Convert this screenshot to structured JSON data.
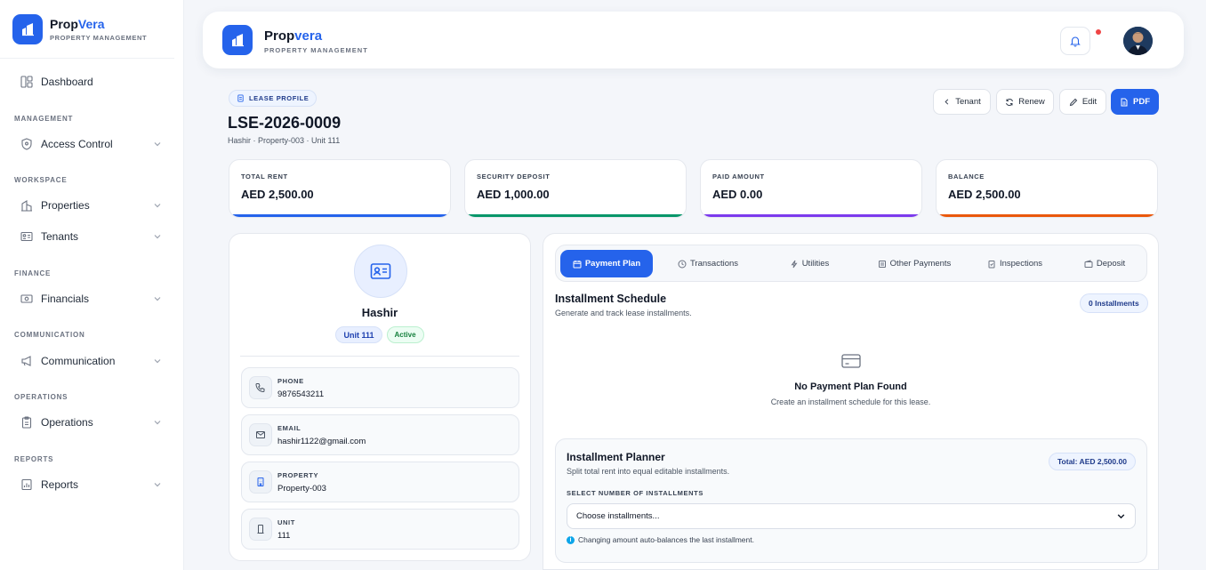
{
  "brand": {
    "name_a": "Prop",
    "name_b": "Vera",
    "sub": "PROPERTY MANAGEMENT"
  },
  "header": {
    "name_a": "Prop",
    "name_b": "vera",
    "sub": "PROPERTY MANAGEMENT",
    "bell_icon": "bell-icon",
    "accent": "#2563eb"
  },
  "sidebar": {
    "dashboard": "Dashboard",
    "sections": [
      "MANAGEMENT",
      "WORKSPACE",
      "FINANCE",
      "COMMUNICATION",
      "OPERATIONS",
      "REPORTS"
    ],
    "items": [
      "Access Control",
      "Properties",
      "Tenants",
      "Financials",
      "Communication",
      "Operations",
      "Reports"
    ]
  },
  "lease": {
    "chip": "LEASE PROFILE",
    "id": "LSE-2026-0009",
    "subtitle": "Hashir · Property-003 · Unit 111",
    "buttons": {
      "tenant": "Tenant",
      "renew": "Renew",
      "edit": "Edit",
      "pdf": "PDF"
    }
  },
  "stats": [
    {
      "label": "TOTAL RENT",
      "value": "AED 2,500.00",
      "color": "#2563eb"
    },
    {
      "label": "SECURITY DEPOSIT",
      "value": "AED 1,000.00",
      "color": "#059669"
    },
    {
      "label": "PAID AMOUNT",
      "value": "AED 0.00",
      "color": "#7c3aed"
    },
    {
      "label": "BALANCE",
      "value": "AED 2,500.00",
      "color": "#ea580c"
    }
  ],
  "tenant": {
    "name": "Hashir",
    "unit_badge": "Unit 111",
    "status": "Active",
    "fields": [
      {
        "label": "PHONE",
        "value": "9876543211"
      },
      {
        "label": "EMAIL",
        "value": "hashir1122@gmail.com"
      },
      {
        "label": "PROPERTY",
        "value": "Property-003"
      },
      {
        "label": "UNIT",
        "value": "111"
      }
    ]
  },
  "tabs": [
    "Payment Plan",
    "Transactions",
    "Utilities",
    "Other Payments",
    "Inspections",
    "Deposit"
  ],
  "schedule": {
    "title": "Installment Schedule",
    "subtitle": "Generate and track lease installments.",
    "count": "0 Installments",
    "empty_title": "No Payment Plan Found",
    "empty_sub": "Create an installment schedule for this lease."
  },
  "planner": {
    "title": "Installment Planner",
    "subtitle": "Split total rent into equal editable installments.",
    "total": "Total: AED 2,500.00",
    "select_label": "SELECT NUMBER OF INSTALLMENTS",
    "select_value": "Choose installments...",
    "hint": "Changing amount auto-balances the last installment."
  }
}
